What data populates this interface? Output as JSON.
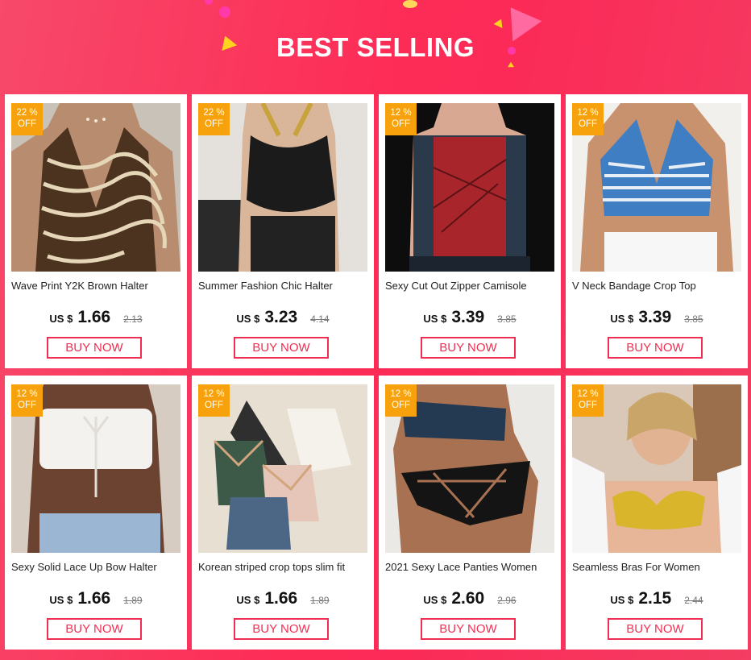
{
  "header": {
    "title": "BEST SELLING"
  },
  "colors": {
    "accent": "#f02d52",
    "badge": "#f7a20c",
    "background": "#fb2a57"
  },
  "products": [
    {
      "discount": "22 %",
      "off": "OFF",
      "name": "Wave Print Y2K Brown Halter",
      "currency": "US $",
      "price": "1.66",
      "old_price": "2.13",
      "button": "BUY NOW",
      "image": "brown-swirl-halter-top"
    },
    {
      "discount": "22 %",
      "off": "OFF",
      "name": "Summer Fashion Chic Halter",
      "currency": "US $",
      "price": "3.23",
      "old_price": "4.14",
      "button": "BUY NOW",
      "image": "black-chain-halter-top"
    },
    {
      "discount": "12 %",
      "off": "OFF",
      "name": "Sexy Cut Out Zipper Camisole",
      "currency": "US $",
      "price": "3.39",
      "old_price": "3.85",
      "button": "BUY NOW",
      "image": "red-corset-camisole"
    },
    {
      "discount": "12 %",
      "off": "OFF",
      "name": "V Neck Bandage Crop Top",
      "currency": "US $",
      "price": "3.39",
      "old_price": "3.85",
      "button": "BUY NOW",
      "image": "blue-striped-halter-top"
    },
    {
      "discount": "12 %",
      "off": "OFF",
      "name": "Sexy Solid Lace Up Bow Halter",
      "currency": "US $",
      "price": "1.66",
      "old_price": "1.89",
      "button": "BUY NOW",
      "image": "white-tube-top"
    },
    {
      "discount": "12 %",
      "off": "OFF",
      "name": "Korean striped crop tops slim fit",
      "currency": "US $",
      "price": "1.66",
      "old_price": "1.89",
      "button": "BUY NOW",
      "image": "bralette-collection"
    },
    {
      "discount": "12 %",
      "off": "OFF",
      "name": "2021 Sexy Lace Panties Women",
      "currency": "US $",
      "price": "2.60",
      "old_price": "2.96",
      "button": "BUY NOW",
      "image": "black-lace-panties"
    },
    {
      "discount": "12 %",
      "off": "OFF",
      "name": "Seamless Bras For Women",
      "currency": "US $",
      "price": "2.15",
      "old_price": "2.44",
      "button": "BUY NOW",
      "image": "yellow-strapless-bra"
    }
  ]
}
